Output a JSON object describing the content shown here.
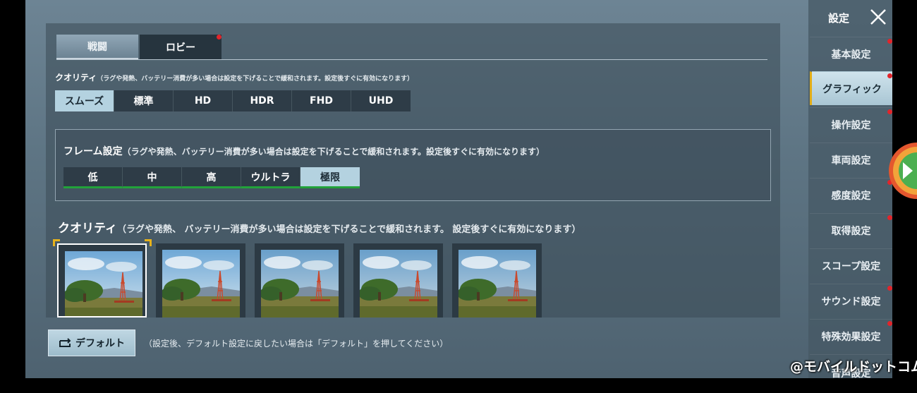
{
  "tabs": [
    {
      "label": "戦闘",
      "selected": true
    },
    {
      "label": "ロビー",
      "selected": false,
      "has_notification": true
    }
  ],
  "quality": {
    "title": "クオリティ",
    "note": "（ラグや発熱、バッテリー消費が多い場合は設定を下げることで緩和されます。設定後すぐに有効になります）",
    "options": [
      "スムーズ",
      "標準",
      "HD",
      "HDR",
      "FHD",
      "UHD"
    ],
    "selected": "スムーズ"
  },
  "frame": {
    "title": "フレーム設定",
    "note": "（ラグや発熱、バッテリー消費が多い場合は設定を下げることで緩和されます。設定後すぐに有効になります）",
    "options": [
      "低",
      "中",
      "高",
      "ウルトラ",
      "極限"
    ],
    "selected": "極限"
  },
  "style_quality": {
    "title": "クオリティ",
    "note": "（ラグや発熱、 バッテリー消費が多い場合は設定を下げることで緩和されます。 設定後すぐに有効になります）",
    "thumbnail_count": 5,
    "selected_index": 0
  },
  "default_button": {
    "label": "デフォルト",
    "icon": "reset-icon",
    "note": "（設定後、デフォルト設定に戻したい場合は「デフォルト」を押してください）"
  },
  "sidebar": {
    "title": "設定",
    "close_icon": "close-icon",
    "items": [
      {
        "label": "基本設定",
        "active": false,
        "dot": true
      },
      {
        "label": "グラフィック",
        "active": true,
        "dot": true
      },
      {
        "label": "操作設定",
        "active": false,
        "dot": true
      },
      {
        "label": "車両設定",
        "active": false,
        "dot": false
      },
      {
        "label": "感度設定",
        "active": false,
        "dot": true
      },
      {
        "label": "取得設定",
        "active": false,
        "dot": true
      },
      {
        "label": "スコープ設定",
        "active": false,
        "dot": false
      },
      {
        "label": "サウンド設定",
        "active": false,
        "dot": true
      },
      {
        "label": "特殊効果設定",
        "active": false,
        "dot": true
      },
      {
        "label": "音声設定",
        "active": false,
        "dot": false
      }
    ]
  },
  "watermark": "@モバイルドットコム",
  "colors": {
    "accent_selected": "#b4d2e0",
    "frame_underline": "#22a23a",
    "notification_dot": "#e1252b",
    "selection_corner": "#e6b21b"
  }
}
